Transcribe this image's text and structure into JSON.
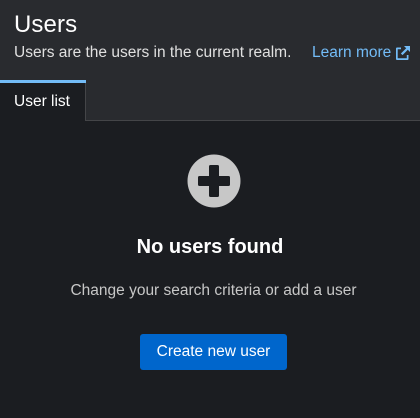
{
  "header": {
    "title": "Users",
    "subtitle": "Users are the users in the current realm.",
    "learn_more_label": "Learn more",
    "learn_more_icon": "external-link-icon"
  },
  "tabs": [
    {
      "label": "User list",
      "active": true
    }
  ],
  "empty_state": {
    "icon": "plus-circle-icon",
    "title": "No users found",
    "body": "Change your search criteria or add a user",
    "button_label": "Create new user"
  },
  "colors": {
    "background": "#1b1d21",
    "header_background": "#292b2f",
    "link": "#73bcf7",
    "primary_button": "#0066cc",
    "icon_gray": "#c7c7c7"
  }
}
